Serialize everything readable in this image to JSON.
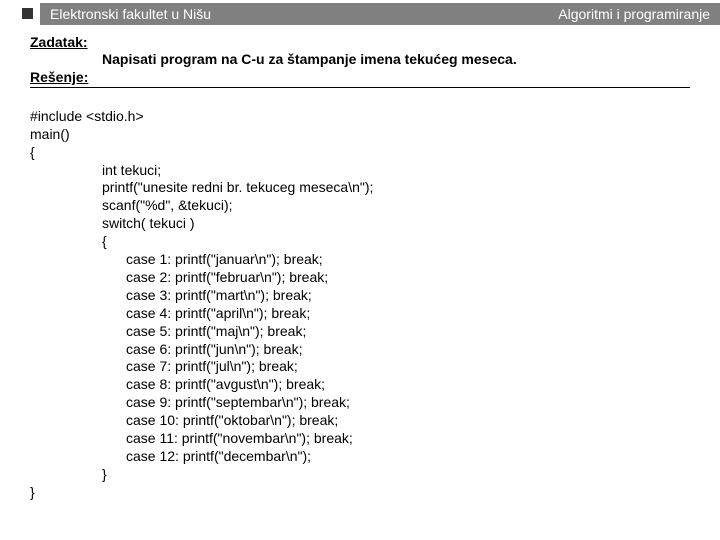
{
  "header": {
    "left": "Elektronski fakultet u Nišu",
    "right": "Algoritmi i programiranje"
  },
  "labels": {
    "zadatak": "Zadatak:",
    "resenje": "Rešenje:"
  },
  "task": "Napisati program na C-u za štampanje imena tekućeg meseca.",
  "code": {
    "l01": "#include <stdio.h>",
    "l02": "main()",
    "l03": "{",
    "l04": "int tekuci;",
    "l05": "printf(\"unesite redni br. tekuceg meseca\\n\");",
    "l06": "scanf(\"%d\", &tekuci);",
    "l07": "switch( tekuci )",
    "l08": "{",
    "l09": "case 1: printf(\"januar\\n\"); break;",
    "l10": "case 2: printf(\"februar\\n\"); break;",
    "l11": "case 3: printf(\"mart\\n\"); break;",
    "l12": "case 4: printf(\"april\\n\"); break;",
    "l13": "case 5: printf(\"maj\\n\"); break;",
    "l14": "case 6: printf(\"jun\\n\"); break;",
    "l15": "case 7: printf(\"jul\\n\"); break;",
    "l16": "case 8: printf(\"avgust\\n\"); break;",
    "l17": "case 9: printf(\"septembar\\n\"); break;",
    "l18": "case 10: printf(\"oktobar\\n\"); break;",
    "l19": "case 11: printf(\"novembar\\n\"); break;",
    "l20": "case 12: printf(\"decembar\\n\");",
    "l21": "}",
    "l22": "}"
  }
}
